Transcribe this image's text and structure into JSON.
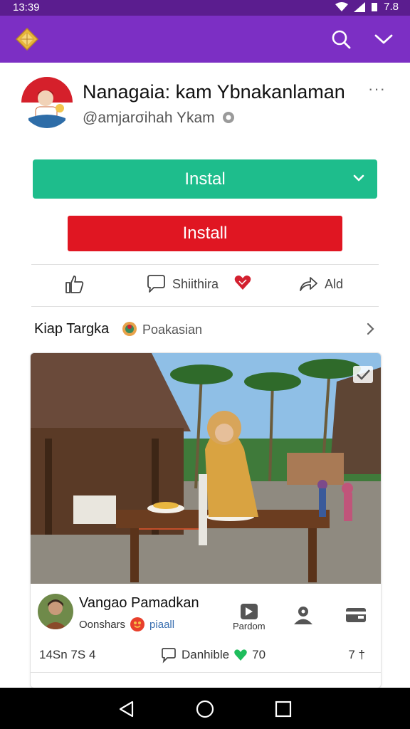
{
  "status_bar": {
    "time": "13:39",
    "battery": "7.8"
  },
  "app_bar": {
    "logo_icon": "diamond-logo-icon",
    "search_icon": "search-icon",
    "menu_icon": "chevron-down-icon"
  },
  "profile": {
    "name": "Nanagaia: kam Ybnakanlaman",
    "handle": "@amjarσihah Ykam",
    "more": "···"
  },
  "buttons": {
    "install_primary": "Instal",
    "install_secondary": "Install"
  },
  "actions": {
    "share_label": "Shiithira",
    "add_label": "Ald"
  },
  "section": {
    "title": "Kiap Targka",
    "subtitle": "Poakasian"
  },
  "post": {
    "author_name": "Vangao Pamadkan",
    "author_tag": "Oonshars",
    "author_link": "piaall",
    "action_label": "Pardom",
    "stats_left": "14Sn 7S 4",
    "stats_mid_label": "Danhible",
    "stats_mid_count": "70",
    "stats_right": "7 †"
  },
  "colors": {
    "status_bar": "#5b1d8f",
    "app_bar": "#7c2fc4",
    "install_green": "#1ebd8c",
    "install_red": "#e01622",
    "heart": "#d3202f"
  }
}
